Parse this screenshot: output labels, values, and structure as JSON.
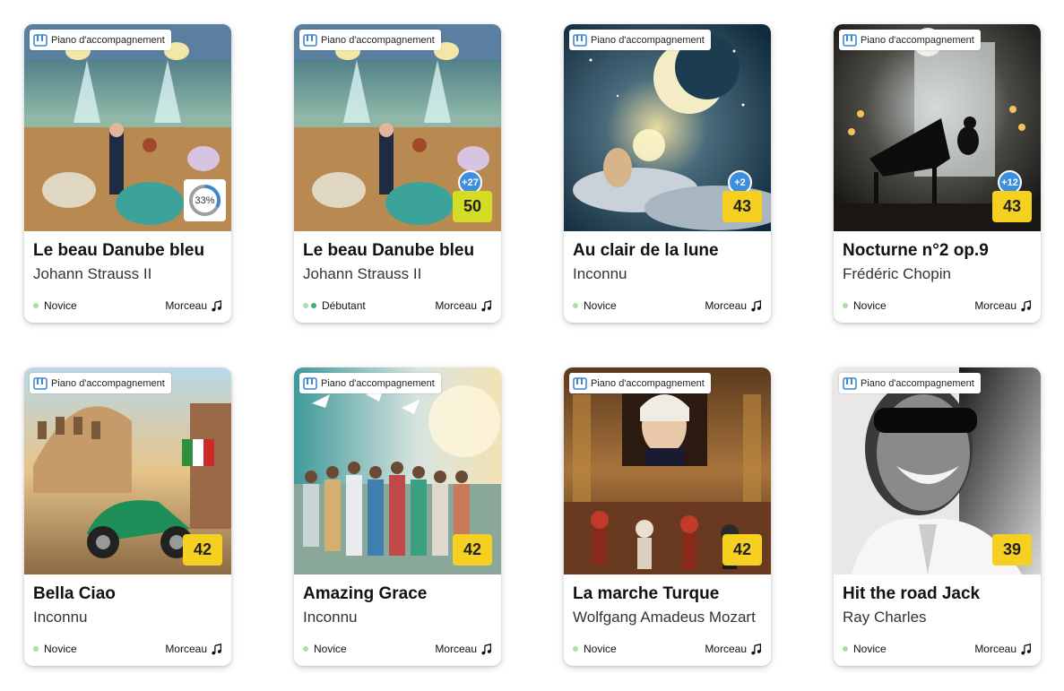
{
  "cards": [
    {
      "tag": "Piano d'accompagnement",
      "title": "Le beau Danube bleu",
      "artist": "Johann Strauss II",
      "level": "Novice",
      "kind": "Morceau",
      "progress": "33%",
      "progress_value": 0.33,
      "art": "ballroom-icon"
    },
    {
      "tag": "Piano d'accompagnement",
      "title": "Le beau Danube bleu",
      "artist": "Johann Strauss II",
      "level": "Débutant",
      "kind": "Morceau",
      "score": "50",
      "plus": "+27",
      "art": "ballroom-icon"
    },
    {
      "tag": "Piano d'accompagnement",
      "title": "Au clair de la lune",
      "artist": "Inconnu",
      "level": "Novice",
      "kind": "Morceau",
      "score": "43",
      "plus": "+2",
      "art": "moon-icon"
    },
    {
      "tag": "Piano d'accompagnement",
      "title": "Nocturne n°2 op.9",
      "artist": "Frédéric Chopin",
      "level": "Novice",
      "kind": "Morceau",
      "score": "43",
      "plus": "+12",
      "art": "piano-icon"
    },
    {
      "tag": "Piano d'accompagnement",
      "title": "Bella Ciao",
      "artist": "Inconnu",
      "level": "Novice",
      "kind": "Morceau",
      "score": "42",
      "art": "scooter-icon"
    },
    {
      "tag": "Piano d'accompagnement",
      "title": "Amazing Grace",
      "artist": "Inconnu",
      "level": "Novice",
      "kind": "Morceau",
      "score": "42",
      "art": "choir-icon"
    },
    {
      "tag": "Piano d'accompagnement",
      "title": "La marche Turque",
      "artist": "Wolfgang Amadeus Mozart",
      "level": "Novice",
      "kind": "Morceau",
      "score": "42",
      "art": "mozart-icon"
    },
    {
      "tag": "Piano d'accompagnement",
      "title": "Hit the road Jack",
      "artist": "Ray Charles",
      "level": "Novice",
      "kind": "Morceau",
      "score": "39",
      "art": "portrait-icon"
    }
  ],
  "colors": {
    "score": "#f5d020",
    "score_high": "#d5dc24",
    "plus_badge": "#3d8fdd",
    "novice_dot": "#a8e0a0",
    "debutant_dot": "#2bb673"
  }
}
